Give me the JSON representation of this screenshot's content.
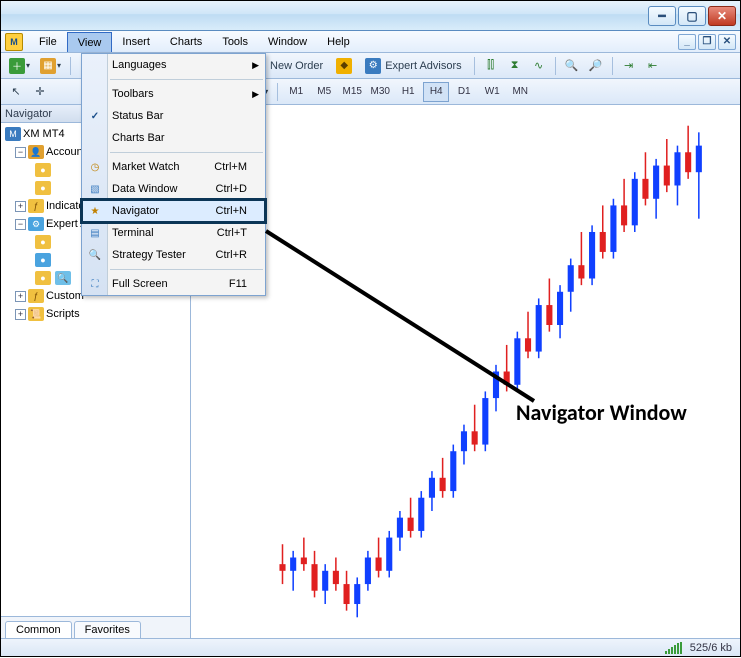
{
  "menus": {
    "file": "File",
    "view": "View",
    "insert": "Insert",
    "charts": "Charts",
    "tools": "Tools",
    "window": "Window",
    "help": "Help"
  },
  "toolbar1": {
    "new_order": "New Order",
    "expert_advisors": "Expert Advisors"
  },
  "timeframes": {
    "m1": "M1",
    "m5": "M5",
    "m15": "M15",
    "m30": "M30",
    "h1": "H1",
    "h4": "H4",
    "d1": "D1",
    "w1": "W1",
    "mn": "MN"
  },
  "navigator": {
    "title": "Navigator",
    "root": "XM MT4",
    "items": {
      "accounts": "Accounts",
      "indicators": "Indicators",
      "expert_advisors": "Expert Advisors",
      "custom": "Custom Indicators",
      "scripts": "Scripts"
    },
    "tabs": {
      "common": "Common",
      "favorites": "Favorites"
    }
  },
  "view_menu": {
    "languages": "Languages",
    "toolbars": "Toolbars",
    "status_bar": "Status Bar",
    "charts_bar": "Charts Bar",
    "market_watch": "Market Watch",
    "market_watch_sc": "Ctrl+M",
    "data_window": "Data Window",
    "data_window_sc": "Ctrl+D",
    "navigator": "Navigator",
    "navigator_sc": "Ctrl+N",
    "terminal": "Terminal",
    "terminal_sc": "Ctrl+T",
    "strategy_tester": "Strategy Tester",
    "strategy_tester_sc": "Ctrl+R",
    "full_screen": "Full Screen",
    "full_screen_sc": "F11"
  },
  "annotation": {
    "text": "Navigator Window"
  },
  "status": {
    "kb": "525/6 kb"
  },
  "chart_data": {
    "type": "bar",
    "title": "",
    "xlabel": "",
    "ylabel": "",
    "note": "candlestick price chart — values approximate, no axes shown",
    "candles": [
      {
        "o": 20,
        "h": 23,
        "l": 17,
        "c": 19,
        "dir": "down"
      },
      {
        "o": 19,
        "h": 22,
        "l": 16,
        "c": 21,
        "dir": "up"
      },
      {
        "o": 21,
        "h": 24,
        "l": 19,
        "c": 20,
        "dir": "down"
      },
      {
        "o": 20,
        "h": 22,
        "l": 15,
        "c": 16,
        "dir": "down"
      },
      {
        "o": 16,
        "h": 20,
        "l": 14,
        "c": 19,
        "dir": "up"
      },
      {
        "o": 19,
        "h": 21,
        "l": 16,
        "c": 17,
        "dir": "down"
      },
      {
        "o": 17,
        "h": 19,
        "l": 13,
        "c": 14,
        "dir": "down"
      },
      {
        "o": 14,
        "h": 18,
        "l": 12,
        "c": 17,
        "dir": "up"
      },
      {
        "o": 17,
        "h": 22,
        "l": 16,
        "c": 21,
        "dir": "up"
      },
      {
        "o": 21,
        "h": 24,
        "l": 18,
        "c": 19,
        "dir": "down"
      },
      {
        "o": 19,
        "h": 25,
        "l": 18,
        "c": 24,
        "dir": "up"
      },
      {
        "o": 24,
        "h": 28,
        "l": 22,
        "c": 27,
        "dir": "up"
      },
      {
        "o": 27,
        "h": 30,
        "l": 24,
        "c": 25,
        "dir": "down"
      },
      {
        "o": 25,
        "h": 31,
        "l": 24,
        "c": 30,
        "dir": "up"
      },
      {
        "o": 30,
        "h": 34,
        "l": 28,
        "c": 33,
        "dir": "up"
      },
      {
        "o": 33,
        "h": 36,
        "l": 30,
        "c": 31,
        "dir": "down"
      },
      {
        "o": 31,
        "h": 38,
        "l": 30,
        "c": 37,
        "dir": "up"
      },
      {
        "o": 37,
        "h": 41,
        "l": 35,
        "c": 40,
        "dir": "up"
      },
      {
        "o": 40,
        "h": 44,
        "l": 37,
        "c": 38,
        "dir": "down"
      },
      {
        "o": 38,
        "h": 46,
        "l": 37,
        "c": 45,
        "dir": "up"
      },
      {
        "o": 45,
        "h": 50,
        "l": 43,
        "c": 49,
        "dir": "up"
      },
      {
        "o": 49,
        "h": 53,
        "l": 46,
        "c": 47,
        "dir": "down"
      },
      {
        "o": 47,
        "h": 55,
        "l": 46,
        "c": 54,
        "dir": "up"
      },
      {
        "o": 54,
        "h": 58,
        "l": 51,
        "c": 52,
        "dir": "down"
      },
      {
        "o": 52,
        "h": 60,
        "l": 51,
        "c": 59,
        "dir": "up"
      },
      {
        "o": 59,
        "h": 63,
        "l": 55,
        "c": 56,
        "dir": "down"
      },
      {
        "o": 56,
        "h": 62,
        "l": 54,
        "c": 61,
        "dir": "up"
      },
      {
        "o": 61,
        "h": 66,
        "l": 58,
        "c": 65,
        "dir": "up"
      },
      {
        "o": 65,
        "h": 70,
        "l": 62,
        "c": 63,
        "dir": "down"
      },
      {
        "o": 63,
        "h": 71,
        "l": 62,
        "c": 70,
        "dir": "up"
      },
      {
        "o": 70,
        "h": 74,
        "l": 66,
        "c": 67,
        "dir": "down"
      },
      {
        "o": 67,
        "h": 75,
        "l": 66,
        "c": 74,
        "dir": "up"
      },
      {
        "o": 74,
        "h": 78,
        "l": 70,
        "c": 71,
        "dir": "down"
      },
      {
        "o": 71,
        "h": 79,
        "l": 70,
        "c": 78,
        "dir": "up"
      },
      {
        "o": 78,
        "h": 82,
        "l": 74,
        "c": 75,
        "dir": "down"
      },
      {
        "o": 75,
        "h": 81,
        "l": 72,
        "c": 80,
        "dir": "up"
      },
      {
        "o": 80,
        "h": 84,
        "l": 76,
        "c": 77,
        "dir": "down"
      },
      {
        "o": 77,
        "h": 83,
        "l": 74,
        "c": 82,
        "dir": "up"
      },
      {
        "o": 82,
        "h": 86,
        "l": 78,
        "c": 79,
        "dir": "down"
      },
      {
        "o": 79,
        "h": 85,
        "l": 72,
        "c": 83,
        "dir": "up"
      }
    ]
  }
}
